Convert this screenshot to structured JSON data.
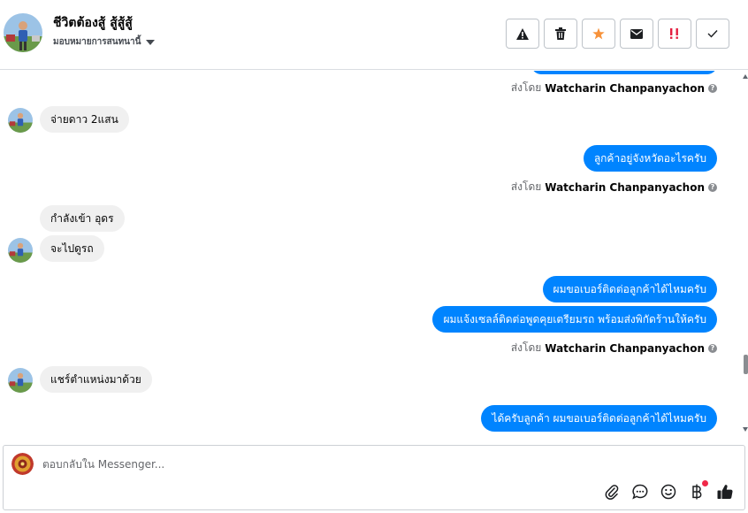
{
  "header": {
    "name": "ชีวิตต้องสู้ สู้สู้สู้",
    "assign_label": "มอบหมายการสนทนานี้",
    "actions": [
      {
        "name": "report-button",
        "icon": "warning-icon"
      },
      {
        "name": "delete-button",
        "icon": "trash-icon"
      },
      {
        "name": "star-button",
        "icon": "star-icon"
      },
      {
        "name": "mark-unread-button",
        "icon": "envelope-icon"
      },
      {
        "name": "spam-button",
        "icon": "spam-icon"
      },
      {
        "name": "done-button",
        "icon": "check-icon"
      }
    ]
  },
  "messages": {
    "sent_by_prefix": "ส่งโดย",
    "sender_name": "Watcharin Chanpanyachon",
    "incoming_1": "จ่ายดาว 2แสน",
    "outgoing_1": "ลูกค้าอยู่จังหวัดอะไรครับ",
    "incoming_2a": "กำลังเข้า อุดร",
    "incoming_2b": "จะไปดูรถ",
    "outgoing_2a": "ผมขอเบอร์ติดต่อลูกค้าได้ไหมครับ",
    "outgoing_2b": "ผมแจ้งเซลล์ติดต่อพูดคุยเตรียมรถ พร้อมส่งพิกัดร้านให้ครับ",
    "incoming_3": "แชร์ตำแหน่งมาด้วย",
    "outgoing_3": "ได้ครับลูกค้า ผมขอเบอร์ติดต่อลูกค้าได้ไหมครับ"
  },
  "composer": {
    "placeholder": "ตอบกลับใน Messenger...",
    "tools": [
      "attach-icon",
      "saved-replies-icon",
      "emoji-icon",
      "baht-icon",
      "thumbs-up-icon"
    ]
  },
  "colors": {
    "outgoing_bubble": "#0084ff",
    "incoming_bubble": "#f0f0f0",
    "star": "#f7923a",
    "spam": "#e41e3f"
  }
}
